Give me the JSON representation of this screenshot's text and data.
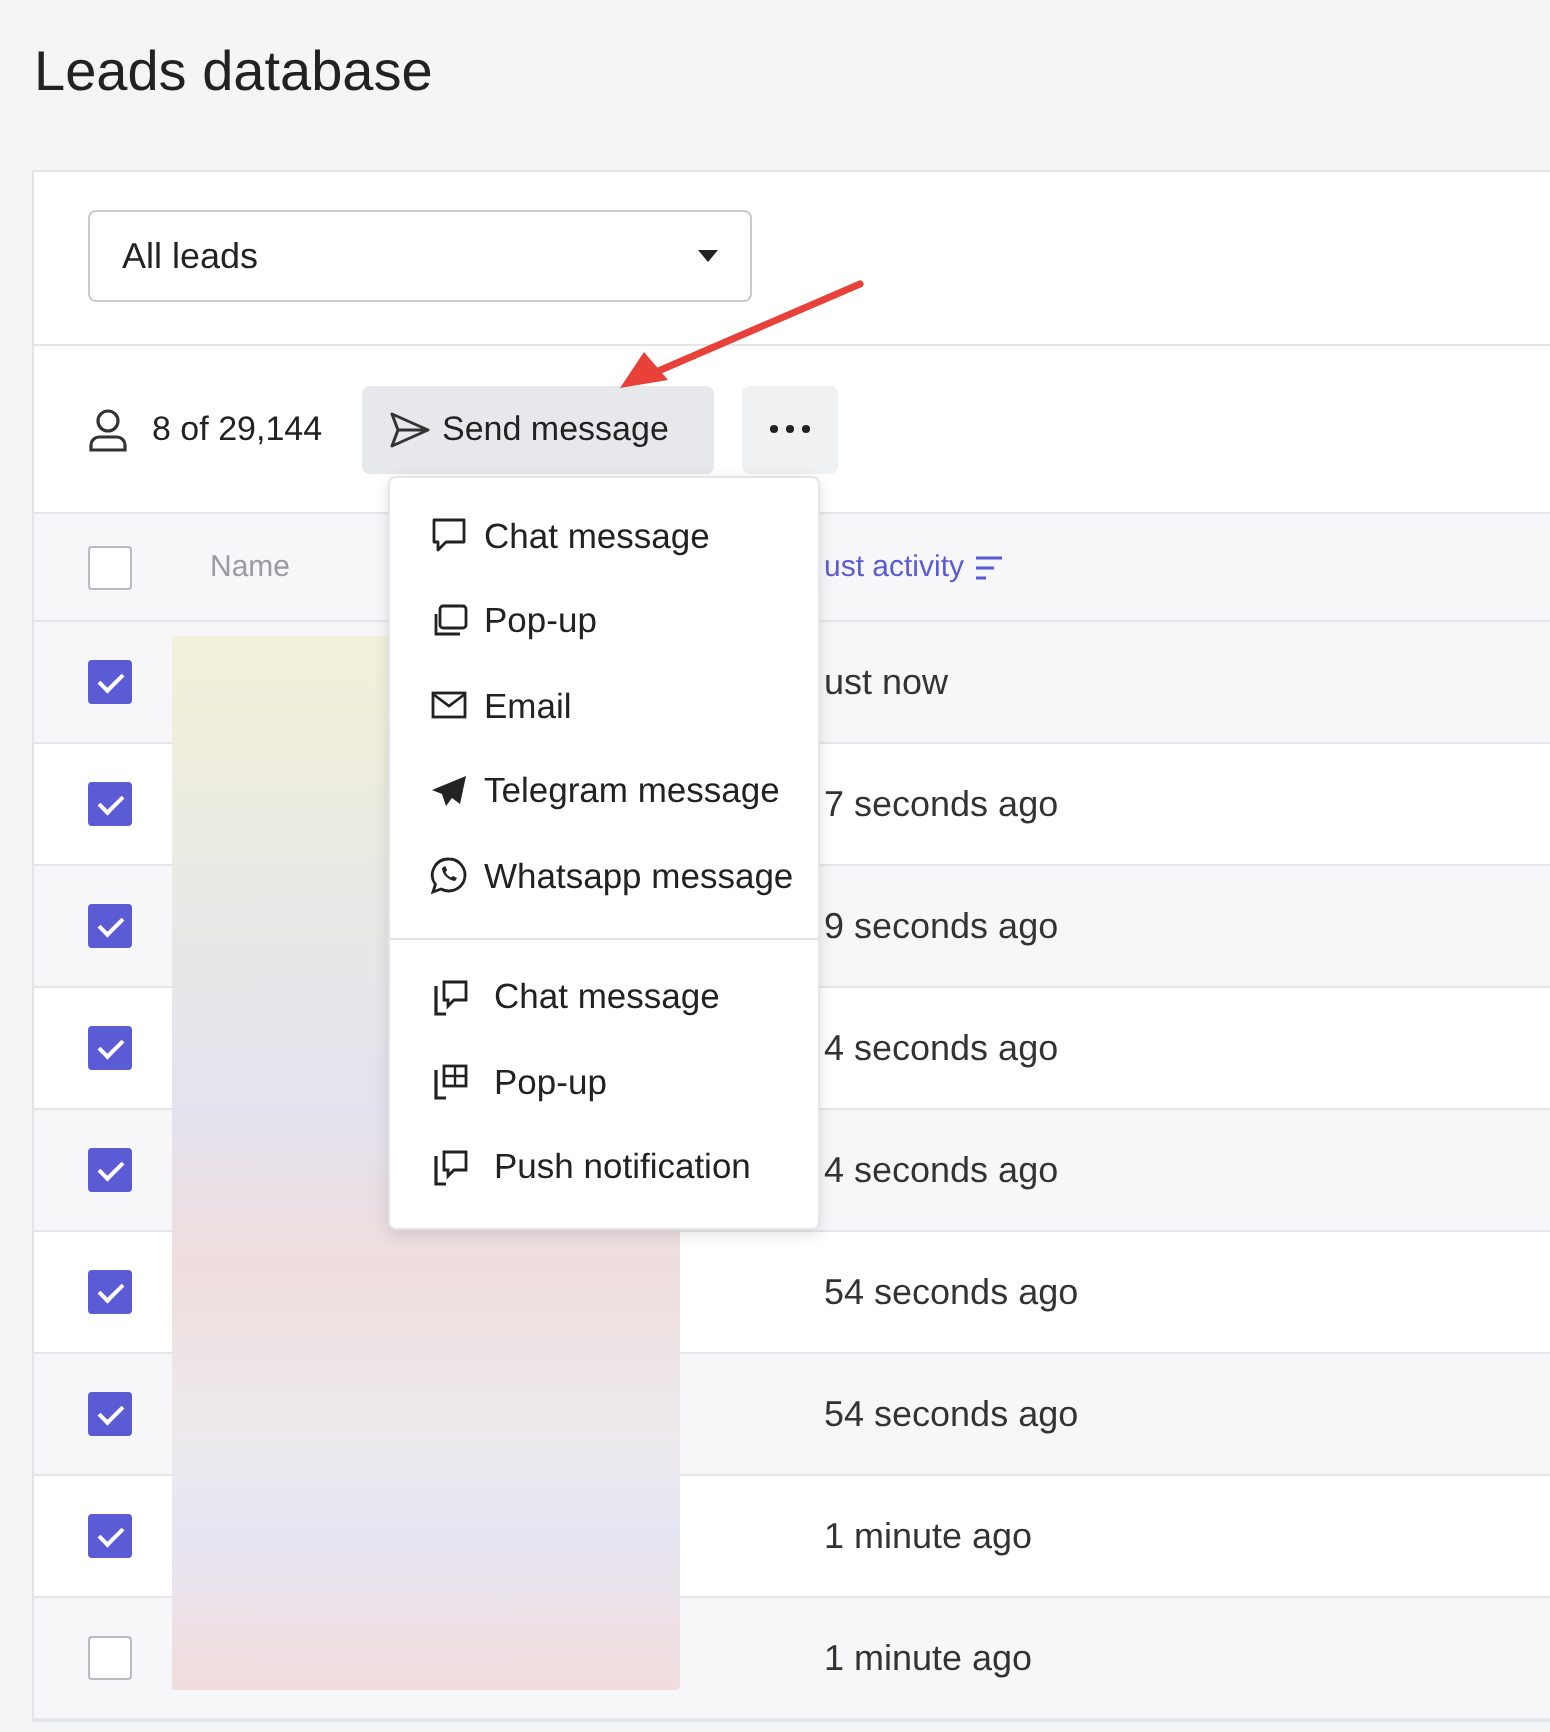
{
  "page": {
    "title": "Leads database"
  },
  "filter": {
    "value": "All leads"
  },
  "toolbar": {
    "count": "8 of 29,144",
    "send_button": "Send message"
  },
  "menu": {
    "sections": [
      {
        "items": [
          {
            "kind": "chat",
            "label": "Chat message"
          },
          {
            "kind": "popup",
            "label": "Pop-up"
          },
          {
            "kind": "email",
            "label": "Email"
          },
          {
            "kind": "telegram",
            "label": "Telegram message"
          },
          {
            "kind": "whatsapp",
            "label": "Whatsapp message"
          }
        ]
      },
      {
        "items": [
          {
            "kind": "mobile-chat",
            "label": "Chat message"
          },
          {
            "kind": "mobile-popup",
            "label": "Pop-up"
          },
          {
            "kind": "mobile-push",
            "label": "Push notification"
          }
        ]
      }
    ]
  },
  "table": {
    "select_all": {
      "checked": false
    },
    "columns": [
      "Name",
      "ust activity"
    ],
    "rows": [
      {
        "checked": true,
        "last_activity": "ust now"
      },
      {
        "checked": true,
        "last_activity": "7 seconds ago"
      },
      {
        "checked": true,
        "last_activity": "9 seconds ago"
      },
      {
        "checked": true,
        "last_activity": "4 seconds ago"
      },
      {
        "checked": true,
        "last_activity": "4 seconds ago"
      },
      {
        "checked": true,
        "last_activity": "54 seconds ago"
      },
      {
        "checked": true,
        "last_activity": "54 seconds ago"
      },
      {
        "checked": true,
        "last_activity": "1 minute ago"
      },
      {
        "checked": false,
        "last_activity": "1 minute ago"
      }
    ]
  }
}
